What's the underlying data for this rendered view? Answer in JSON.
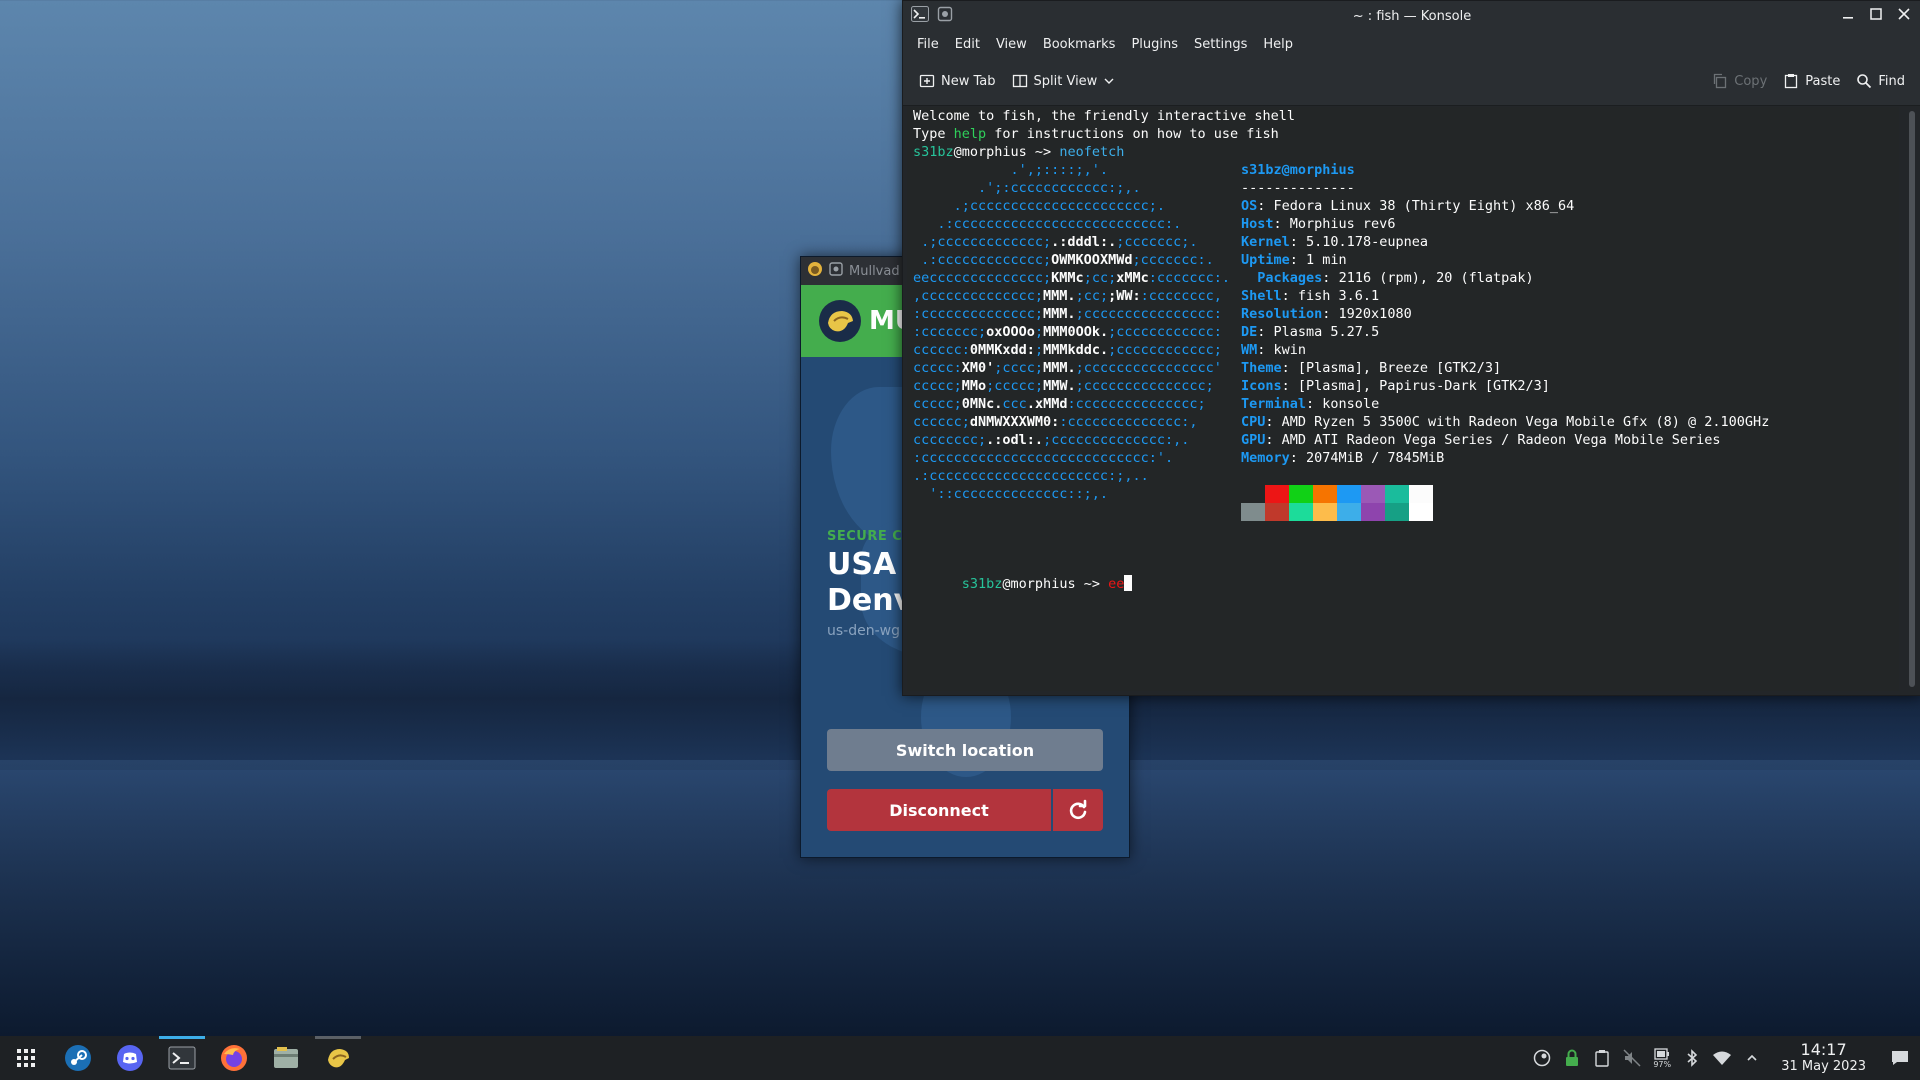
{
  "konsole": {
    "title": "~ : fish — Konsole",
    "menu": [
      "File",
      "Edit",
      "View",
      "Bookmarks",
      "Plugins",
      "Settings",
      "Help"
    ],
    "toolbar": {
      "new_tab": "New Tab",
      "split_view": "Split View",
      "copy": "Copy",
      "paste": "Paste",
      "find": "Find"
    },
    "terminal": {
      "welcome1": "Welcome to fish, the friendly interactive shell",
      "welcome2_a": "Type ",
      "welcome2_help": "help",
      "welcome2_b": " for instructions on how to use fish",
      "user": "s31bz",
      "host": "@morphius",
      "arrow": " ~> ",
      "cmd1": "neofetch",
      "cmd2": "ee",
      "info_title_user": "s31bz",
      "info_title_host": "@morphius",
      "separator": "--------------",
      "info": [
        {
          "k": "OS",
          "v": "Fedora Linux 38 (Thirty Eight) x86_64"
        },
        {
          "k": "Host",
          "v": "Morphius rev6"
        },
        {
          "k": "Kernel",
          "v": "5.10.178-eupnea"
        },
        {
          "k": "Uptime",
          "v": "1 min"
        },
        {
          "k": "Packages",
          "v": "2116 (rpm), 20 (flatpak)"
        },
        {
          "k": "Shell",
          "v": "fish 3.6.1"
        },
        {
          "k": "Resolution",
          "v": "1920x1080"
        },
        {
          "k": "DE",
          "v": "Plasma 5.27.5"
        },
        {
          "k": "WM",
          "v": "kwin"
        },
        {
          "k": "Theme",
          "v": "[Plasma], Breeze [GTK2/3]"
        },
        {
          "k": "Icons",
          "v": "[Plasma], Papirus-Dark [GTK2/3]"
        },
        {
          "k": "Terminal",
          "v": "konsole"
        },
        {
          "k": "CPU",
          "v": "AMD Ryzen 5 3500C with Radeon Vega Mobile Gfx (8) @ 2.100GHz"
        },
        {
          "k": "GPU",
          "v": "AMD ATI Radeon Vega Series / Radeon Vega Mobile Series"
        },
        {
          "k": "Memory",
          "v": "2074MiB / 7845MiB"
        }
      ],
      "ascii": [
        [
          "            .',;::::;,'.",
          ""
        ],
        [
          "        .';:cccccccccccc:;,.",
          ""
        ],
        [
          "     .;cccccccccccccccccccccc;.",
          ""
        ],
        [
          "   .:cccccccccccccccccccccccccc:.",
          ""
        ],
        [
          " .;ccccccccccccc;",
          ".:dddl:.",
          ";ccccccc;."
        ],
        [
          " .:ccccccccccccc;",
          "OWMKOOXMWd",
          ";ccccccc:."
        ],
        [
          "eecccccccccccccc;",
          "KMMc",
          ";cc;",
          "xMMc",
          ":ccccccc:."
        ],
        [
          ",cccccccccccccc;",
          "MMM.",
          ";cc;",
          ";WW:",
          ":cccccccc,"
        ],
        [
          ":cccccccccccccc;",
          "MMM.",
          ";cccccccccccccccc:"
        ],
        [
          ":ccccccc;",
          "oxOOOo",
          ";",
          "MMM0OOk.",
          ";cccccccccccc:"
        ],
        [
          "cccccc:",
          "0MMKxdd:",
          ";",
          "MMMkddc.",
          ";cccccccccccc;"
        ],
        [
          "ccccc:",
          "XM0'",
          ";cccc;",
          "MMM.",
          ";cccccccccccccccc'"
        ],
        [
          "ccccc;",
          "MMo",
          ";ccccc;",
          "MMW.",
          ";ccccccccccccccc;"
        ],
        [
          "ccccc;",
          "0MNc.",
          "ccc",
          ".xMMd",
          ":ccccccccccccccc;"
        ],
        [
          "cccccc;",
          "dNMWXXXWM0:",
          ":cccccccccccccc:,"
        ],
        [
          "cccccccc;",
          ".:odl:.",
          ";cccccccccccccc:,."
        ],
        [
          ":cccccccccccccccccccccccccccc:'.",
          ""
        ],
        [
          ".:cccccccccccccccccccccc:;,..",
          ""
        ],
        [
          "  '::cccccccccccccc::;,.",
          ""
        ]
      ],
      "palette_top": [
        "#232627",
        "#ed1515",
        "#11d116",
        "#f67400",
        "#1d99f3",
        "#9b59b6",
        "#1abc9c",
        "#fcfcfc"
      ],
      "palette_bottom": [
        "#7f8c8d",
        "#c0392b",
        "#1cdc9a",
        "#fdbc4b",
        "#3daee9",
        "#8e44ad",
        "#16a085",
        "#ffffff"
      ]
    }
  },
  "mullvad": {
    "title": "Mullvad",
    "brand": "MU",
    "secure_label": "SECURE CO",
    "country": "USA",
    "city": "Denve",
    "hostname": "us-den-wg",
    "switch_location": "Switch location",
    "disconnect": "Disconnect"
  },
  "taskbar": {
    "time": "14:17",
    "date": "31 May 2023",
    "battery": "97%"
  }
}
